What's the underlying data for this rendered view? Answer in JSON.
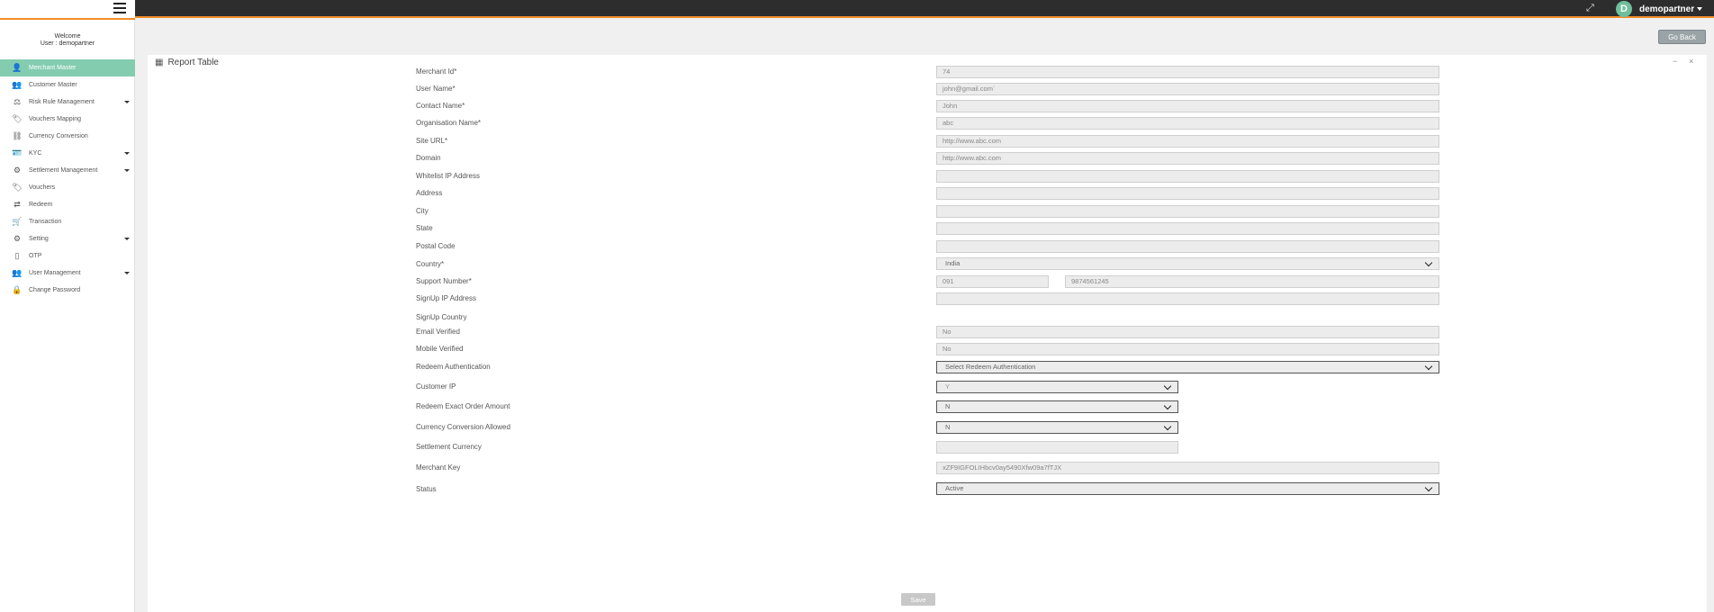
{
  "header": {
    "user_initial": "D",
    "user_name": "demopartner"
  },
  "sidebar": {
    "welcome_line1": "Welcome",
    "welcome_line2": "User : demopartner",
    "items": [
      {
        "label": "Merchant Master",
        "icon": "user-icon",
        "glyph": "👤",
        "active": true,
        "caret": false
      },
      {
        "label": "Customer Master",
        "icon": "users-icon",
        "glyph": "👥",
        "active": false,
        "caret": false
      },
      {
        "label": "Risk Rule Management",
        "icon": "balance-icon",
        "glyph": "⚖",
        "active": false,
        "caret": true
      },
      {
        "label": "Vouchers Mapping",
        "icon": "tags-icon",
        "glyph": "🏷",
        "active": false,
        "caret": false
      },
      {
        "label": "Currency Conversion",
        "icon": "sitemap-icon",
        "glyph": "⛓",
        "active": false,
        "caret": false
      },
      {
        "label": "KYC",
        "icon": "id-card-icon",
        "glyph": "🪪",
        "active": false,
        "caret": true
      },
      {
        "label": "Settlement Management",
        "icon": "gear-icon",
        "glyph": "⚙",
        "active": false,
        "caret": true
      },
      {
        "label": "Vouchers",
        "icon": "tags-icon",
        "glyph": "🏷",
        "active": false,
        "caret": false
      },
      {
        "label": "Redeem",
        "icon": "exchange-icon",
        "glyph": "⇄",
        "active": false,
        "caret": false
      },
      {
        "label": "Transaction",
        "icon": "cart-icon",
        "glyph": "🛒",
        "active": false,
        "caret": false
      },
      {
        "label": "Setting",
        "icon": "gear-icon",
        "glyph": "⚙",
        "active": false,
        "caret": true
      },
      {
        "label": "OTP",
        "icon": "mobile-icon",
        "glyph": "▯",
        "active": false,
        "caret": false
      },
      {
        "label": "User Management",
        "icon": "users-cog-icon",
        "glyph": "👥",
        "active": false,
        "caret": true
      },
      {
        "label": "Change Password",
        "icon": "lock-icon",
        "glyph": "🔒",
        "active": false,
        "caret": false
      }
    ]
  },
  "toolbar": {
    "go_back_label": "Go Back"
  },
  "panel": {
    "title": "Report Table",
    "minimize_glyph": "−",
    "close_glyph": "×"
  },
  "form": {
    "merchant_id": {
      "label": "Merchant Id*",
      "value": "74"
    },
    "user_name": {
      "label": "User Name*",
      "value": "john@gmail.com`"
    },
    "contact_name": {
      "label": "Contact Name*",
      "value": "John"
    },
    "organisation_name": {
      "label": "Organisation Name*",
      "value": "abc"
    },
    "site_url": {
      "label": "Site URL*",
      "value": "http://www.abc.com"
    },
    "domain": {
      "label": "Domain",
      "value": "http://www.abc.com"
    },
    "whitelist_ip": {
      "label": "Whitelist IP Address",
      "value": ""
    },
    "address": {
      "label": "Address",
      "value": ""
    },
    "city": {
      "label": "City",
      "value": ""
    },
    "state": {
      "label": "State",
      "value": ""
    },
    "postal_code": {
      "label": "Postal Code",
      "value": ""
    },
    "country": {
      "label": "Country*",
      "value": "India"
    },
    "support_number": {
      "label": "Support Number*",
      "code": "091",
      "number": "9874561245"
    },
    "signup_ip": {
      "label": "SignUp IP Address",
      "value": ""
    },
    "signup_country": {
      "label": "SignUp Country"
    },
    "email_verified": {
      "label": "Email Verified",
      "value": "No"
    },
    "mobile_verified": {
      "label": "Mobile Verified",
      "value": "No"
    },
    "redeem_authentication": {
      "label": "Redeem Authentication",
      "value": "Select Redeem Authentication"
    },
    "customer_ip": {
      "label": "Customer IP",
      "value": "Y"
    },
    "redeem_exact_order_amount": {
      "label": "Redeem Exact Order Amount",
      "value": "N"
    },
    "currency_conversion_allowed": {
      "label": "Currency Conversion Allowed",
      "value": "N"
    },
    "settlement_currency": {
      "label": "Settlement Currency",
      "value": ""
    },
    "merchant_key": {
      "label": "Merchant Key",
      "value": "xZF9IGFOLIHbcv0ay5490Xfw09a7fTJX"
    },
    "status": {
      "label": "Status",
      "value": "Active"
    },
    "save_label": "Save"
  }
}
